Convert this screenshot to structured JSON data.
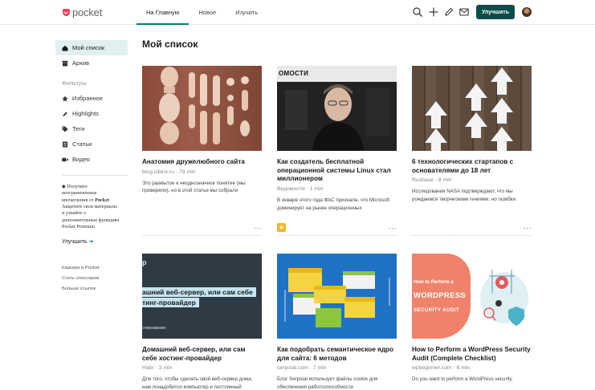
{
  "header": {
    "logo_text": "pocket",
    "nav": [
      {
        "label": "На Главную",
        "active": true
      },
      {
        "label": "Новое",
        "active": false
      },
      {
        "label": "Изучить",
        "active": false
      }
    ],
    "icons": [
      "search-icon",
      "add-icon",
      "edit-icon",
      "mail-icon"
    ],
    "upgrade_label": "Улучшить",
    "accent": "#008078",
    "button_color": "#0b4d48"
  },
  "sidebar": {
    "items": [
      {
        "label": "Мой список",
        "icon": "home-icon",
        "active": true
      },
      {
        "label": "Архив",
        "icon": "archive-icon",
        "active": false
      }
    ],
    "filters_label": "Фильтры",
    "filters": [
      {
        "label": "Избранное",
        "icon": "star-icon"
      },
      {
        "label": "Highlights",
        "icon": "highlight-icon"
      },
      {
        "label": "Теги",
        "icon": "tag-icon"
      },
      {
        "label": "Статьи",
        "icon": "article-icon"
      },
      {
        "label": "Видео",
        "icon": "video-icon"
      }
    ],
    "promo_line1": "Получите",
    "promo_line2": "неограниченные",
    "promo_line3": "впечатления от",
    "promo_brand": "Pocket",
    "promo_line4": "Защитите свои материалы и узнайте о дополнительных функциях Pocket Premium",
    "promo_link": "Улучшить",
    "footer": [
      "Карьера в Pocket",
      "Стать спонсором",
      "Больше ссылок"
    ]
  },
  "main": {
    "title": "Мой список",
    "cards": [
      {
        "title": "Анатомия дружелюбного сайта",
        "meta": "blog.sibirix.ru · 79 min",
        "excerpt": "Это размытое и неоднозначное понятие (мы проверяли), но в этой статье мы собрали",
        "favorite": false
      },
      {
        "title": "Как создатель бесплатной операционной системы Linux стал миллионером",
        "meta": "Ведомости · 1 min",
        "excerpt": "В январе этого года ФАС признала, что Microsoft доминирует на рынке операционных",
        "favorite": true,
        "thumb_text": "ОМОСТИ"
      },
      {
        "title": "6 технологических стартапов с основателями до 18 лет",
        "meta": "Rusbase · 8 min",
        "excerpt": "Исследования NASA подтверждают, что мы рождаемся творческими гениями, но ошибки",
        "favorite": false
      },
      {
        "title": "Домашний веб-сервер, или сам себе хостинг-провайдер",
        "meta": "Habr · 3 min",
        "excerpt": "Для того, чтобы сделать свой веб-сервер дома, нам понадобится компьютер и постоянный",
        "favorite": false,
        "thumb_lines": [
          "р",
          "ашний веб-сервер, или сам себе",
          "тинг-провайдер",
          "стирование"
        ]
      },
      {
        "title": "Как подобрать семантическое ядро для сайта: 6 методов",
        "meta": "serpstat.com · 7 min",
        "excerpt": "Блог Serpstat использует файлы cookie для обеспечения работоспособности",
        "favorite": false
      },
      {
        "title": "How to Perform a WordPress Security Audit (Complete Checklist)",
        "meta": "wpbeginner.com · 6 min",
        "excerpt": "Do you want to perform a WordPress security",
        "favorite": false,
        "thumb_lines": [
          "How to Perform a",
          "WORDPRESS",
          "SECURITY AUDIT"
        ]
      }
    ],
    "more_label": "···"
  }
}
